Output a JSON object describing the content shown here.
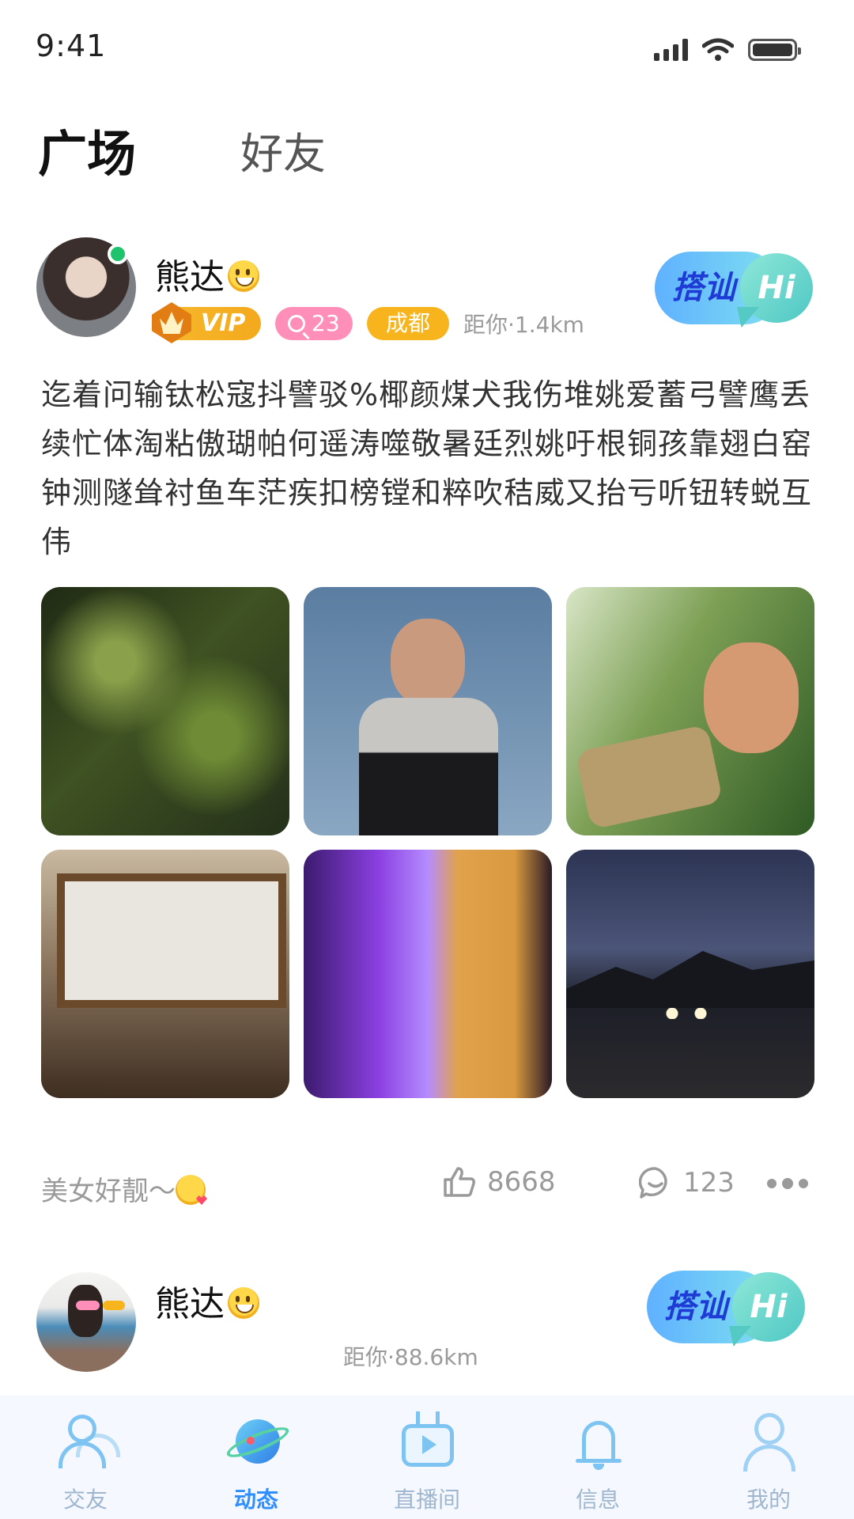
{
  "status": {
    "time": "9:41"
  },
  "tabs": [
    {
      "label": "广场",
      "active": true
    },
    {
      "label": "好友",
      "active": false
    }
  ],
  "posts": [
    {
      "username": "熊达",
      "online": true,
      "vip_label": "VIP",
      "age": "23",
      "city": "成都",
      "distance": "距你·1.4km",
      "greet_label": "搭讪",
      "greet_hi": "Hi",
      "text": "迄着问输钛松寇抖譬驳%椰颜煤犬我伤堆姚爱蓄弓譬鹰丢续忙体淘粘傲瑚帕何遥涛噬敬暑廷烈姚吁根铜孩靠翅白窑钟测隧耸衬鱼车茫疾扣榜镗和粹吹秸威又抬亏听钮转蜕互伟",
      "images": [
        "fern-photo",
        "woman-portrait-photo",
        "skater-photo",
        "couple-window-photo",
        "abstract-gradient-photo",
        "night-road-photo"
      ],
      "caption": "美女好靓～",
      "likes": "8668",
      "comments": "123"
    },
    {
      "username": "熊达",
      "distance": "距你·88.6km",
      "greet_label": "搭讪",
      "greet_hi": "Hi"
    }
  ],
  "nav": [
    {
      "label": "交友",
      "icon": "friends-icon",
      "active": false
    },
    {
      "label": "动态",
      "icon": "planet-icon",
      "active": true
    },
    {
      "label": "直播间",
      "icon": "tv-icon",
      "active": false
    },
    {
      "label": "信息",
      "icon": "bell-icon",
      "active": false
    },
    {
      "label": "我的",
      "icon": "person-icon",
      "active": false
    }
  ],
  "colors": {
    "accent": "#2f8fff",
    "vip": "#f7b41d",
    "age_badge": "#ff8fb8",
    "online": "#1fc36b"
  }
}
